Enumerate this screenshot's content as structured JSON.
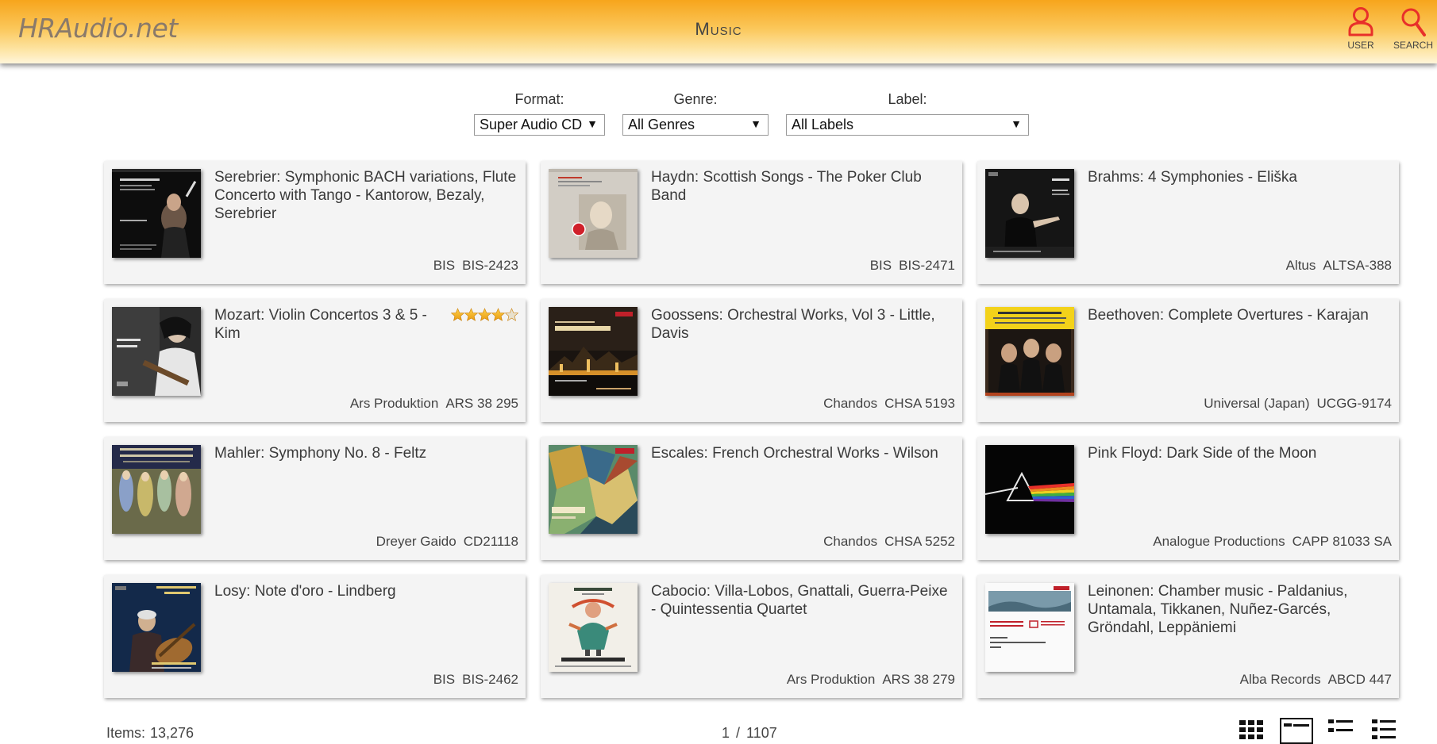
{
  "header": {
    "logo": "HRAudio.net",
    "title": "Music",
    "user_label": "USER",
    "search_label": "SEARCH",
    "accent_color": "#f7a51c",
    "icon_color": "#e8302a"
  },
  "filters": {
    "format": {
      "label": "Format:",
      "value": "Super Audio CD"
    },
    "genre": {
      "label": "Genre:",
      "value": "All Genres"
    },
    "label": {
      "label": "Label:",
      "value": "All Labels"
    }
  },
  "albums": [
    {
      "title": "Serebrier: Symphonic BACH variations, Flute Concerto with Tango - Kantorow, Bezaly, Serebrier",
      "label": "BIS",
      "catalog": "BIS-2423"
    },
    {
      "title": "Haydn: Scottish Songs - The Poker Club Band",
      "label": "BIS",
      "catalog": "BIS-2471"
    },
    {
      "title": "Brahms: 4 Symphonies - Eliška",
      "label": "Altus",
      "catalog": "ALTSA-388"
    },
    {
      "title": "Mozart: Violin Concertos 3 & 5 - Kim",
      "label": "Ars Produktion",
      "catalog": "ARS 38 295",
      "rating": 4.5
    },
    {
      "title": "Goossens: Orchestral Works, Vol 3 - Little, Davis",
      "label": "Chandos",
      "catalog": "CHSA 5193"
    },
    {
      "title": "Beethoven: Complete Overtures - Karajan",
      "label": "Universal (Japan)",
      "catalog": "UCGG-9174"
    },
    {
      "title": "Mahler: Symphony No. 8 - Feltz",
      "label": "Dreyer Gaido",
      "catalog": "CD21118"
    },
    {
      "title": "Escales: French Orchestral Works - Wilson",
      "label": "Chandos",
      "catalog": "CHSA 5252"
    },
    {
      "title": "Pink Floyd: Dark Side of the Moon",
      "label": "Analogue Productions",
      "catalog": "CAPP 81033 SA"
    },
    {
      "title": "Losy: Note d'oro - Lindberg",
      "label": "BIS",
      "catalog": "BIS-2462"
    },
    {
      "title": "Cabocio: Villa-Lobos, Gnattali, Guerra-Peixe - Quintessentia Quartet",
      "label": "Ars Produktion",
      "catalog": "ARS 38 279"
    },
    {
      "title": "Leinonen: Chamber music - Paldanius, Untamala, Tikkanen, Nuñez-Garcés, Gröndahl, Leppäniemi",
      "label": "Alba Records",
      "catalog": "ABCD 447"
    }
  ],
  "footer": {
    "items_label": "Items:",
    "items_count": "13,276",
    "page_current": "1",
    "page_separator": "/",
    "page_total": "1107",
    "view_modes": [
      "grid-view-icon",
      "cover-list-view-icon",
      "compact-list-view-icon",
      "detail-list-view-icon"
    ]
  }
}
